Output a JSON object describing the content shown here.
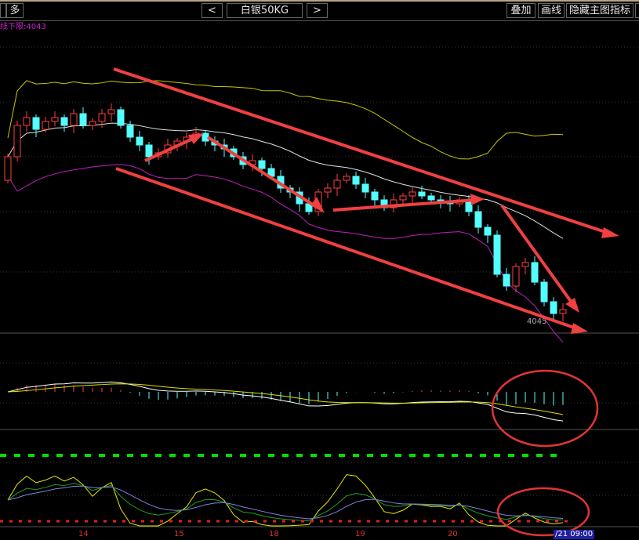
{
  "toolbar": {
    "direction_label": "多",
    "prev_label": "<",
    "symbol": "白银50KG",
    "next_label": ">",
    "overlay_label": "叠加",
    "draw_label": "画线",
    "hide_indicator_label": "隐藏主图指标"
  },
  "indicator_text": "线下限:4043",
  "colors": {
    "up": "#ff4040",
    "down": "#54ffff",
    "upper_band": "#c8c800",
    "mid": "#e0e0e0",
    "lower_band": "#c020c0",
    "arrow": "#f04040"
  },
  "chart_data": {
    "type": "candlestick",
    "title": "白银50KG",
    "ylim": [
      4020,
      4405
    ],
    "low_label": "4045",
    "x_ticks": [
      "14",
      "15",
      "18",
      "19",
      "20",
      "/21 09:00"
    ],
    "closes": [
      4245,
      4285,
      4295,
      4280,
      4290,
      4295,
      4285,
      4300,
      4285,
      4290,
      4300,
      4305,
      4285,
      4270,
      4260,
      4245,
      4250,
      4260,
      4265,
      4270,
      4275,
      4265,
      4260,
      4255,
      4245,
      4235,
      4240,
      4230,
      4220,
      4205,
      4200,
      4185,
      4175,
      4200,
      4205,
      4215,
      4220,
      4210,
      4200,
      4190,
      4180,
      4190,
      4195,
      4200,
      4195,
      4190,
      4187,
      4185,
      4190,
      4175,
      4155,
      4145,
      4095,
      4080,
      4105,
      4110,
      4085,
      4060,
      4045,
      4050
    ],
    "first_open": 4215
  }
}
